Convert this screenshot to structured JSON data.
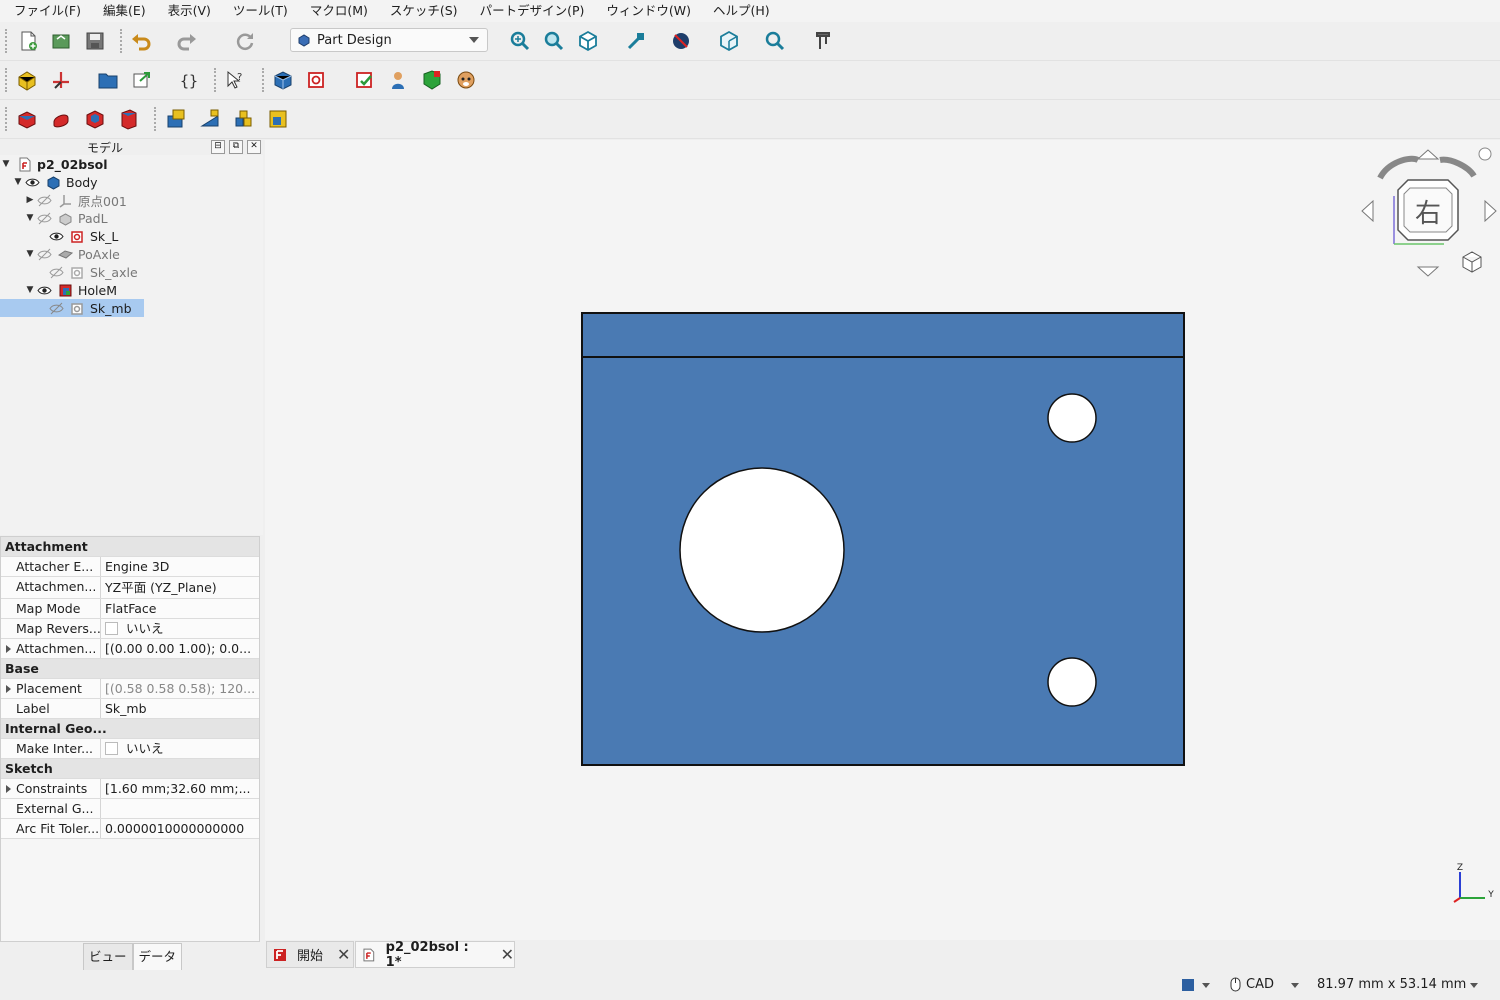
{
  "menu": [
    "ファイル(F)",
    "編集(E)",
    "表示(V)",
    "ツール(T)",
    "マクロ(M)",
    "スケッチ(S)",
    "パートデザイン(P)",
    "ウィンドウ(W)",
    "ヘルプ(H)"
  ],
  "toolbar": {
    "workbench": "Part Design"
  },
  "panel": {
    "title": "モデル",
    "tree": [
      {
        "label": "p2_02bsol"
      },
      {
        "label": "Body"
      },
      {
        "label": "原点001"
      },
      {
        "label": "PadL"
      },
      {
        "label": "Sk_L"
      },
      {
        "label": "PoAxle"
      },
      {
        "label": "Sk_axle"
      },
      {
        "label": "HoleM"
      },
      {
        "label": "Sk_mb"
      }
    ],
    "tabs": [
      "ビュー",
      "データ"
    ]
  },
  "properties": {
    "groups": {
      "attachment": "Attachment",
      "base": "Base",
      "internal": "Internal Geo...",
      "sketch": "Sketch"
    },
    "rows": {
      "attacher_engine": {
        "name": "Attacher E...",
        "value": "Engine 3D"
      },
      "attachment_support": {
        "name": "Attachmen...",
        "value": "YZ平面 (YZ_Plane)"
      },
      "map_mode": {
        "name": "Map Mode",
        "value": "FlatFace"
      },
      "map_reversed": {
        "name": "Map Revers...",
        "value": "いいえ"
      },
      "attachment_offset": {
        "name": "Attachmen...",
        "value": "[(0.00 0.00 1.00); 0.0..."
      },
      "placement": {
        "name": "Placement",
        "value": "[(0.58 0.58 0.58); 120..."
      },
      "label": {
        "name": "Label",
        "value": "Sk_mb"
      },
      "make_internals": {
        "name": "Make Inter...",
        "value": "いいえ"
      },
      "constraints": {
        "name": "Constraints",
        "value": "[1.60 mm;32.60 mm;..."
      },
      "external_geo": {
        "name": "External G...",
        "value": ""
      },
      "arc_fit": {
        "name": "Arc Fit Toler...",
        "value": "0.0000010000000000"
      }
    }
  },
  "view": {
    "navcube_face": "右",
    "axis_z": "Z",
    "axis_y": "Y",
    "part_color": "#4a7ab3"
  },
  "doctabs": [
    {
      "label": "開始"
    },
    {
      "label": "p2_02bsol : 1*"
    }
  ],
  "status": {
    "nav_style": "CAD",
    "dimensions": "81.97 mm x 53.14 mm"
  }
}
